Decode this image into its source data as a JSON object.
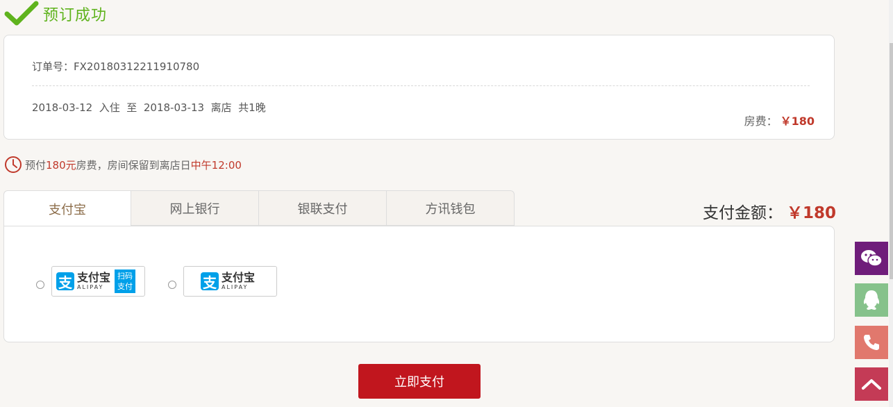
{
  "header": {
    "title": "预订成功"
  },
  "order": {
    "number_line": "订单号：FX20180312211910780",
    "checkin_date": "2018-03-12",
    "checkin_label": "入住",
    "to_label": "至",
    "checkout_date": "2018-03-13",
    "checkout_label": "离店",
    "nights": "共1晚",
    "fee_label": "房费：",
    "fee_amount": "￥180"
  },
  "notice": {
    "prefix": "预付",
    "amount": "180元",
    "middle": "房费，房间保留到离店日",
    "time": "中午12:00"
  },
  "tabs": [
    "支付宝",
    "网上银行",
    "银联支付",
    "方讯钱包"
  ],
  "payment": {
    "total_label": "支付金额：",
    "total_amount": "￥180",
    "options": [
      {
        "logo_char": "支",
        "name": "支付宝",
        "en": "ALIPAY",
        "badge_line1": "扫码",
        "badge_line2": "支付"
      },
      {
        "logo_char": "支",
        "name": "支付宝",
        "en": "ALIPAY"
      }
    ],
    "button_label": "立即支付"
  },
  "sidebar": {
    "icons": [
      "wechat-icon",
      "qq-icon",
      "phone-icon",
      "back-to-top-icon"
    ]
  },
  "colors": {
    "success_green": "#5fb31d",
    "accent_red": "#c1161e",
    "alipay_blue": "#00a0e9",
    "wechat_purple": "#6f1d7a",
    "qq_green": "#86c28b",
    "phone_salmon": "#e1786d",
    "top_pink": "#c43b56"
  }
}
